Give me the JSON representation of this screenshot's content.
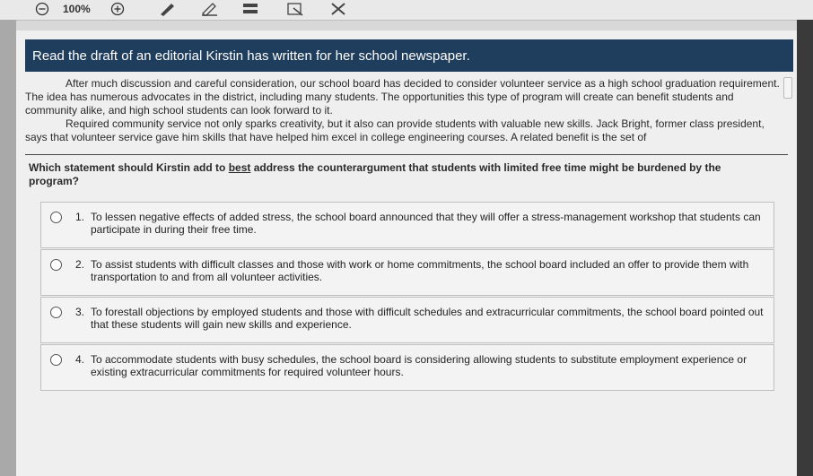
{
  "toolbar": {
    "zoom_label": "100%",
    "icons": [
      "zoom-out-icon",
      "zoom-in-icon",
      "pen-icon",
      "highlighter-icon",
      "line-reader-icon",
      "answer-masking-icon",
      "eliminate-choice-icon"
    ]
  },
  "header": {
    "title": "Read the draft of an editorial Kirstin has written for her school newspaper."
  },
  "passage": {
    "paragraph1": "After much discussion and careful consideration, our school board has decided to consider volunteer service as a high school graduation requirement. The idea has numerous advocates in the district, including many students. The opportunities this type of program will create can benefit students and community alike, and high school students can look forward to it.",
    "paragraph2": "Required community service not only sparks creativity, but it also can provide students with valuable new skills. Jack Bright, former class president, says that volunteer service gave him skills that have helped him excel in college engineering courses. A related benefit is the set of"
  },
  "question": {
    "text_before": "Which statement should Kirstin add to ",
    "emphasis": "best",
    "text_after": " address the counterargument that students with limited free time might be burdened by the program?"
  },
  "options": [
    {
      "number": "1.",
      "text": "To lessen negative effects of added stress, the school board announced that they will offer a stress-management workshop that students can participate in during their free time."
    },
    {
      "number": "2.",
      "text": "To assist students with difficult classes and those with work or home commitments, the school board included an offer to provide them with transportation to and from all volunteer activities."
    },
    {
      "number": "3.",
      "text": "To forestall objections by employed students and those with difficult schedules and extracurricular commitments, the school board pointed out that these students will gain new skills and experience."
    },
    {
      "number": "4.",
      "text": "To accommodate students with busy schedules, the school board is considering allowing students to substitute employment experience or existing extracurricular commitments for required volunteer hours."
    }
  ],
  "colors": {
    "header_bg": "#1f3d5c",
    "header_text": "#ffffff",
    "option_bg": "#f3f3f3"
  }
}
